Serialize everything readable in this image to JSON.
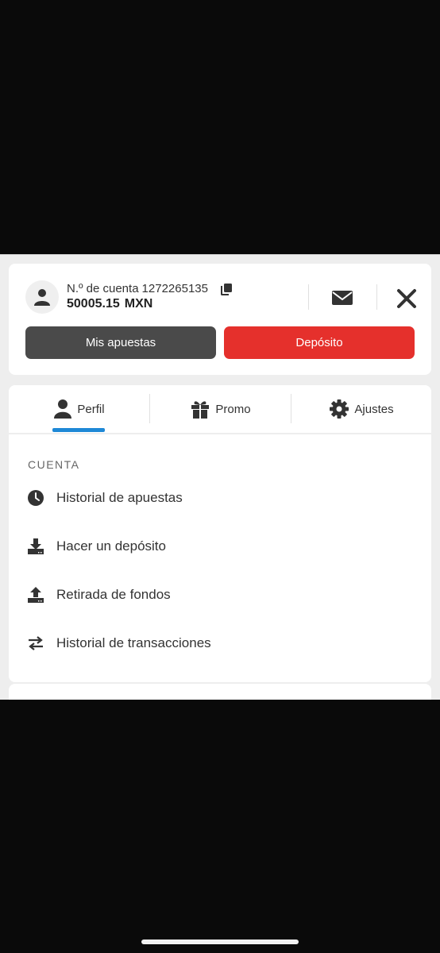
{
  "account": {
    "number_label": "N.º de cuenta",
    "number": "1272265135",
    "balance": "50005.15",
    "currency": "MXN"
  },
  "buttons": {
    "my_bets": "Mis apuestas",
    "deposit": "Depósito"
  },
  "tabs": [
    {
      "label": "Perfil",
      "icon": "person-icon",
      "active": true
    },
    {
      "label": "Promo",
      "icon": "gift-icon",
      "active": false
    },
    {
      "label": "Ajustes",
      "icon": "gear-icon",
      "active": false
    }
  ],
  "menu": {
    "section_title": "CUENTA",
    "items": [
      {
        "label": "Historial de apuestas",
        "icon": "clock-icon"
      },
      {
        "label": "Hacer un depósito",
        "icon": "download-tray-icon"
      },
      {
        "label": "Retirada de fondos",
        "icon": "upload-tray-icon"
      },
      {
        "label": "Historial de transacciones",
        "icon": "swap-arrows-icon"
      }
    ]
  },
  "colors": {
    "deposit_red": "#e5302c",
    "bets_gray": "#4a4a4a",
    "tab_indicator_blue": "#1e88d6"
  }
}
